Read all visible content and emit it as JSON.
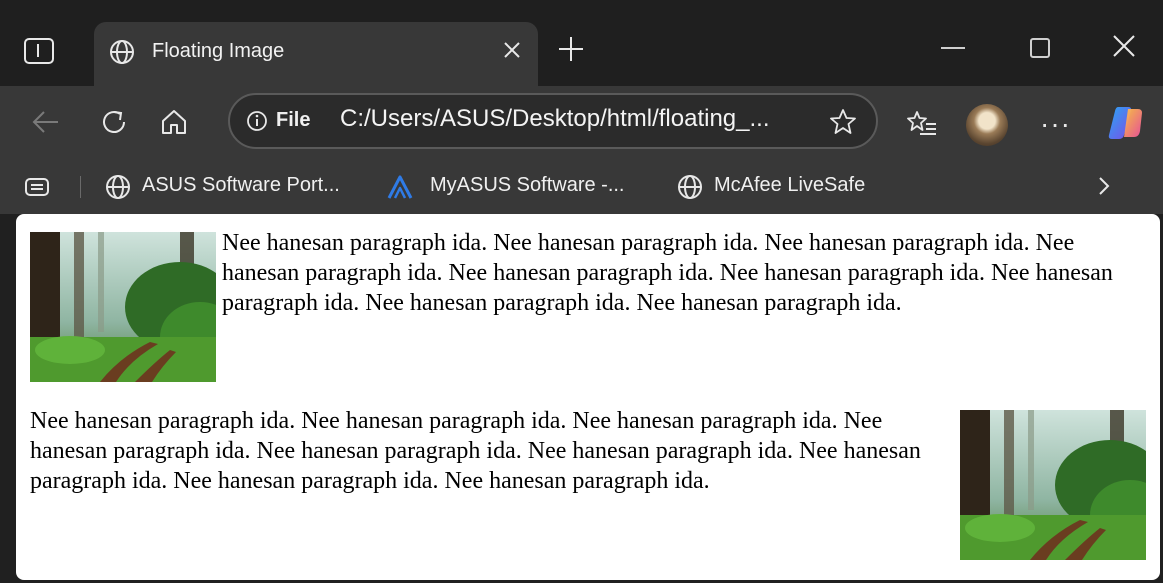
{
  "tab": {
    "title": "Floating Image"
  },
  "address_bar": {
    "scheme_label": "File",
    "url": "C:/Users/ASUS/Desktop/html/floating_..."
  },
  "bookmarks": [
    {
      "label": "ASUS Software Port...",
      "icon": "globe-icon"
    },
    {
      "label": "MyASUS Software -...",
      "icon": "myasus-logo-icon"
    },
    {
      "label": "McAfee LiveSafe",
      "icon": "globe-icon"
    }
  ],
  "page": {
    "paragraphs": [
      {
        "image_side": "left",
        "image": "forest-path-image",
        "text": "Nee hanesan paragraph ida. Nee hanesan paragraph ida. Nee hanesan paragraph ida. Nee hanesan paragraph ida. Nee hanesan paragraph ida. Nee hanesan paragraph ida. Nee hanesan paragraph ida. Nee hanesan paragraph ida. Nee hanesan paragraph ida."
      },
      {
        "image_side": "right",
        "image": "forest-path-image",
        "text": "Nee hanesan paragraph ida. Nee hanesan paragraph ida. Nee hanesan paragraph ida. Nee hanesan paragraph ida. Nee hanesan paragraph ida. Nee hanesan paragraph ida. Nee hanesan paragraph ida. Nee hanesan paragraph ida. Nee hanesan paragraph ida."
      }
    ]
  },
  "colors": {
    "frame": "#202020",
    "toolbar": "#383838",
    "active_tab": "#383838",
    "page_bg": "#ffffff",
    "myasus_blue": "#2f7be6"
  }
}
